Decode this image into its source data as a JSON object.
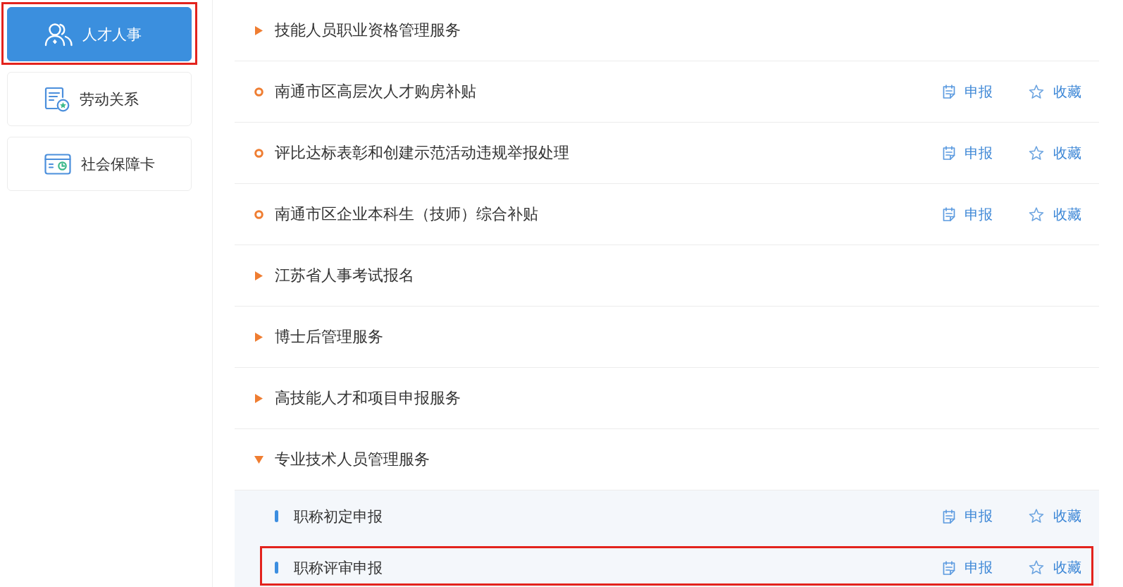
{
  "sidebar": {
    "items": [
      {
        "label": "人才人事",
        "selected": true,
        "highlighted": true
      },
      {
        "label": "劳动关系",
        "selected": false,
        "highlighted": false
      },
      {
        "label": "社会保障卡",
        "selected": false,
        "highlighted": false
      }
    ]
  },
  "services": [
    {
      "kind": "group",
      "title": "技能人员职业资格管理服务",
      "expanded": false
    },
    {
      "kind": "service",
      "title": "南通市区高层次人才购房补贴",
      "actions": [
        {
          "kind": "apply",
          "label": "申报"
        },
        {
          "kind": "favorite",
          "label": "收藏"
        }
      ]
    },
    {
      "kind": "service",
      "title": "评比达标表彰和创建示范活动违规举报处理",
      "actions": [
        {
          "kind": "apply",
          "label": "申报"
        },
        {
          "kind": "favorite",
          "label": "收藏"
        }
      ]
    },
    {
      "kind": "service",
      "title": "南通市区企业本科生（技师）综合补贴",
      "actions": [
        {
          "kind": "apply",
          "label": "申报"
        },
        {
          "kind": "favorite",
          "label": "收藏"
        }
      ]
    },
    {
      "kind": "group",
      "title": "江苏省人事考试报名",
      "expanded": false
    },
    {
      "kind": "group",
      "title": "博士后管理服务",
      "expanded": false
    },
    {
      "kind": "group",
      "title": "高技能人才和项目申报服务",
      "expanded": false
    },
    {
      "kind": "group",
      "title": "专业技术人员管理服务",
      "expanded": true,
      "children": [
        {
          "title": "职称初定申报",
          "highlighted": false,
          "actions": [
            {
              "kind": "apply",
              "label": "申报"
            },
            {
              "kind": "favorite",
              "label": "收藏"
            }
          ]
        },
        {
          "title": "职称评审申报",
          "highlighted": true,
          "actions": [
            {
              "kind": "apply",
              "label": "申报"
            },
            {
              "kind": "favorite",
              "label": "收藏"
            }
          ]
        }
      ]
    }
  ]
}
